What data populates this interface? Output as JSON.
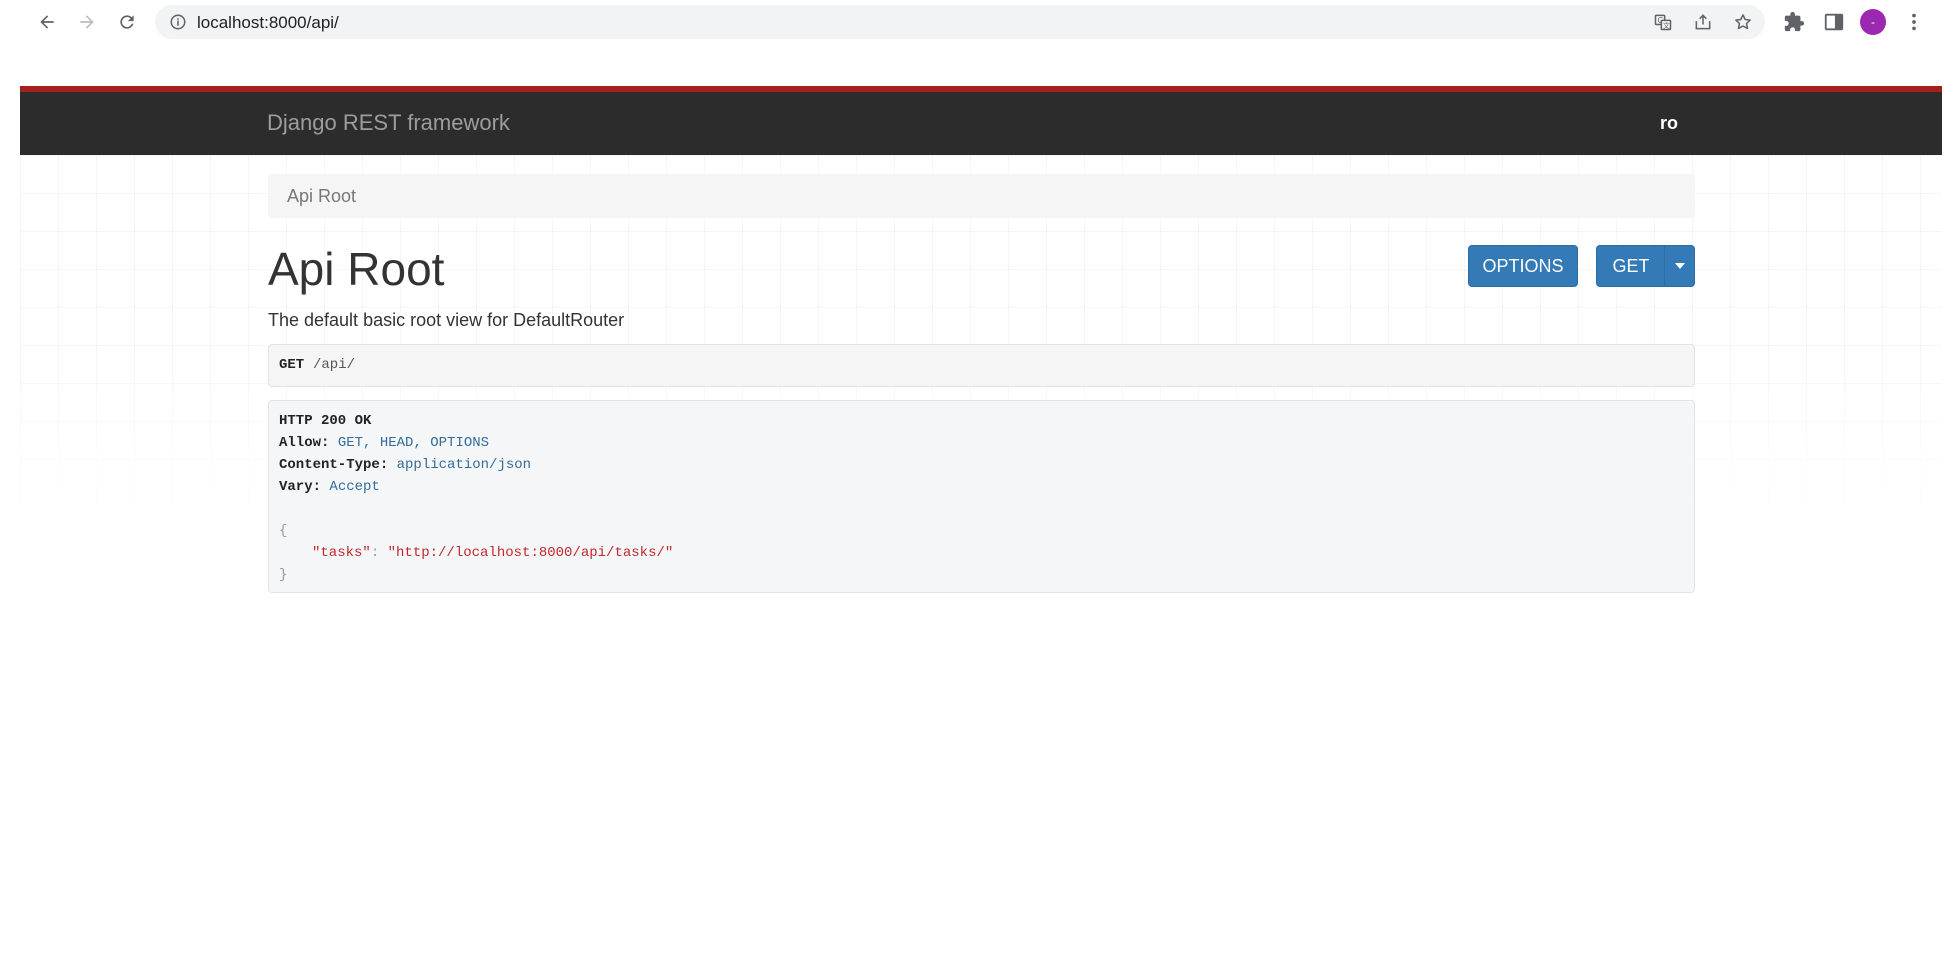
{
  "browser": {
    "url": "localhost:8000/api/",
    "avatar_initial": "-"
  },
  "navbar": {
    "brand": "Django REST framework",
    "user": "ro"
  },
  "breadcrumb": {
    "label": "Api Root"
  },
  "header": {
    "title": "Api Root",
    "description": "The default basic root view for DefaultRouter"
  },
  "buttons": {
    "options_label": "OPTIONS",
    "get_label": "GET"
  },
  "request": {
    "method": "GET",
    "path": "/api/"
  },
  "response": {
    "status": "HTTP 200 OK",
    "headers": [
      {
        "name": "Allow:",
        "value": "GET, HEAD, OPTIONS"
      },
      {
        "name": "Content-Type:",
        "value": "application/json"
      },
      {
        "name": "Vary:",
        "value": "Accept"
      }
    ],
    "body_open": "{",
    "body_close": "}",
    "body_key": "\"tasks\"",
    "body_colon": ": ",
    "body_value": "\"http://localhost:8000/api/tasks/\""
  },
  "colors": {
    "navbar_bg": "#2c2c2c",
    "navbar_accent": "#a52019",
    "button_primary": "#337ab7",
    "avatar": "#9c27b0"
  }
}
